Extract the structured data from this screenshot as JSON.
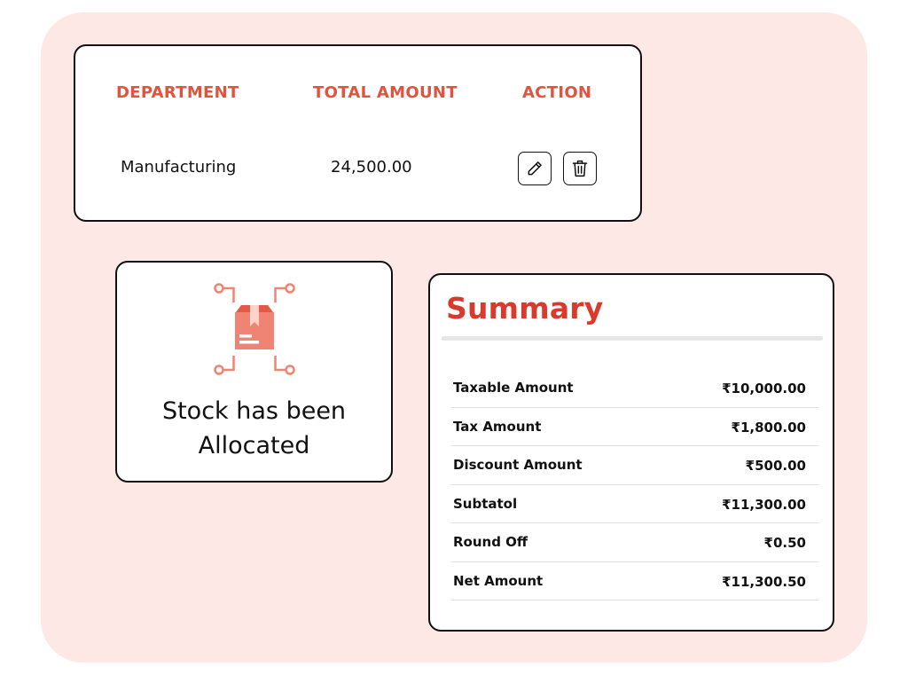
{
  "table": {
    "headers": {
      "department": "DEPARTMENT",
      "total_amount": "TOTAL AMOUNT",
      "action": "ACTION"
    },
    "rows": [
      {
        "department": "Manufacturing",
        "total_amount": "24,500.00",
        "actions": [
          "pencil-icon",
          "trash-icon"
        ]
      }
    ]
  },
  "stock": {
    "icon": "package-box-icon",
    "message_line1": "Stock has been",
    "message_line2": "Allocated"
  },
  "summary": {
    "title": "Summary",
    "rows": [
      {
        "label": "Taxable Amount",
        "value": "₹10,000.00"
      },
      {
        "label": "Tax Amount",
        "value": "₹1,800.00"
      },
      {
        "label": "Discount Amount",
        "value": "₹500.00"
      },
      {
        "label": "Subtatol",
        "value": "₹11,300.00"
      },
      {
        "label": "Round Off",
        "value": "₹0.50"
      },
      {
        "label": "Net Amount",
        "value": "₹11,300.50"
      }
    ]
  },
  "colors": {
    "accent": "#e0533f",
    "title": "#d93a2b",
    "background": "#fde8e6",
    "box_icon": "#f08474"
  }
}
